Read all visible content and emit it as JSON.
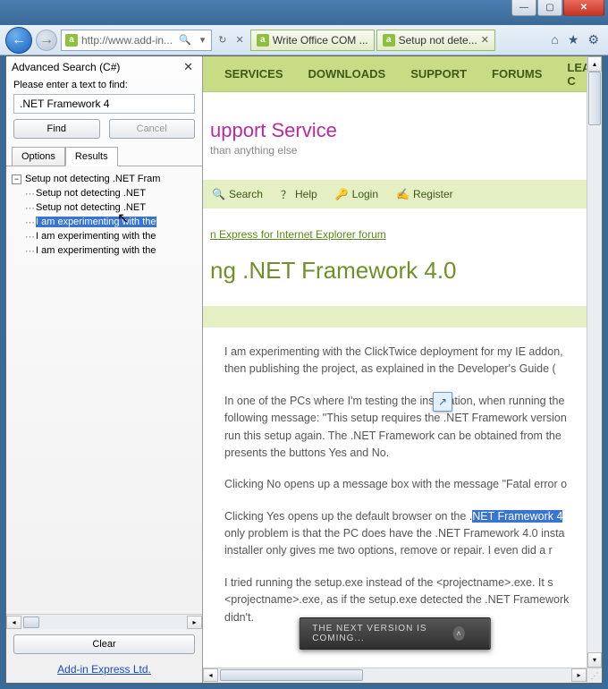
{
  "window": {
    "min": "—",
    "max": "▢",
    "close": "✕"
  },
  "toolbar": {
    "back": "←",
    "forward": "→",
    "url": "http://www.add-in...",
    "search_hint": "🔍",
    "refresh": "↻",
    "stop": "✕",
    "tabs": [
      {
        "label": "Write Office COM ..."
      },
      {
        "label": "Setup not dete..."
      }
    ],
    "home": "⌂",
    "fav": "★",
    "gear": "⚙"
  },
  "sidebar": {
    "title": "Advanced Search (C#)",
    "close": "✕",
    "prompt": "Please enter a text to find:",
    "input_value": ".NET Framework 4",
    "find": "Find",
    "cancel": "Cancel",
    "tab_options": "Options",
    "tab_results": "Results",
    "tree_root": "Setup not detecting .NET Fram",
    "tree_items": [
      "Setup not detecting .NET",
      "Setup not detecting .NET",
      "I am experimenting with the",
      "I am experimenting with the",
      "I am experimenting with the"
    ],
    "selected_index": 2,
    "clear": "Clear",
    "footer_link": "Add-in Express Ltd."
  },
  "page": {
    "nav": [
      "SERVICES",
      "DOWNLOADS",
      "SUPPORT",
      "FORUMS",
      "LEARNING C"
    ],
    "head_title": "upport Service",
    "head_sub": "than anything else",
    "toolbar2": {
      "search": "Search",
      "help": "Help",
      "login": "Login",
      "register": "Register"
    },
    "crumb": "n Express for Internet Explorer forum",
    "title": "ng .NET Framework 4.0",
    "p1": "I am experimenting with the ClickTwice deployment for my IE addon, then publishing the project, as explained in the Developer's Guide (",
    "p2a": "In one of the PCs where I'm testing the installation, when running the following message: \"This setup requires the .NET Framework version run this setup again. The .NET Framework can be obtained from the presents the buttons Yes and No.",
    "p3": "Clicking No opens up a message box with the message \"Fatal error o",
    "p4a": "Clicking Yes opens up the default browser on the .",
    "p4_hl": "NET Framework 4",
    "p4b": " only problem is that the PC does have the .NET Framework 4.0 insta installer only gives me two options, remove or repair. I even did a r",
    "p5": "I tried running the setup.exe instead of the <projectname>.exe. It s <projectname>.exe, as if the setup.exe detected the .NET Framework didn't.",
    "banner": "THE NEXT VERSION IS COMING...",
    "banner_chev": "˄"
  }
}
